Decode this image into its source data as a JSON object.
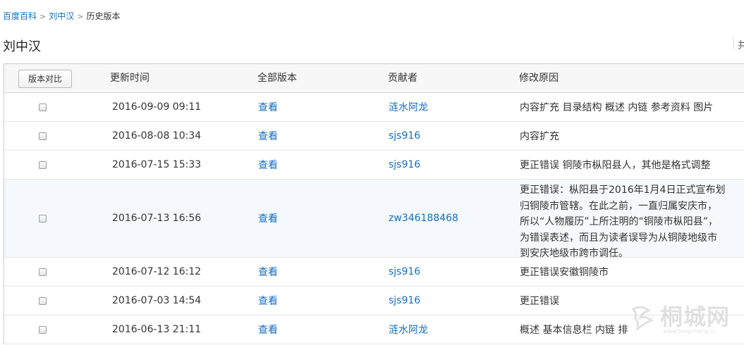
{
  "breadcrumb": {
    "items": [
      "百度百科",
      "刘中汉"
    ],
    "current": "历史版本",
    "separator": ">"
  },
  "page_title": "刘中汉",
  "edge_text": "共",
  "table": {
    "compare_button": "版本对比",
    "headers": {
      "time": "更新时间",
      "version": "全部版本",
      "contributor": "贡献者",
      "reason": "修改原因"
    },
    "rows": [
      {
        "time": "2016-09-09 09:11",
        "view": "查看",
        "contributor": "涟水阿龙",
        "reason": "内容扩充 目录结构 概述 内链 参考资料 图片"
      },
      {
        "time": "2016-08-08 10:34",
        "view": "查看",
        "contributor": "sjs916",
        "reason": "内容扩充"
      },
      {
        "time": "2016-07-15 15:33",
        "view": "查看",
        "contributor": "sjs916",
        "reason": "更正错误 铜陵市枞阳县人，其他是格式调整"
      },
      {
        "time": "2016-07-13 16:56",
        "view": "查看",
        "contributor": "zw346188468",
        "reason": "更正错误：枞阳县于2016年1月4日正式宣布划归铜陵市管辖。在此之前，一直归属安庆市，所以“人物履历”上所注明的“铜陵市枞阳县”，为错误表述，而且为读者误导为从铜陵地级市到安庆地级市跨市调任。"
      },
      {
        "time": "2016-07-12 16:12",
        "view": "查看",
        "contributor": "sjs916",
        "reason": "更正错误安徽铜陵市"
      },
      {
        "time": "2016-07-03 14:54",
        "view": "查看",
        "contributor": "sjs916",
        "reason": "更正错误"
      },
      {
        "time": "2016-06-13 21:11",
        "view": "查看",
        "contributor": "涟水阿龙",
        "reason": "概述 基本信息栏 内链 排"
      }
    ]
  },
  "watermark": {
    "text": "桐城网",
    "url_text": "www.tongcheng.cc"
  }
}
